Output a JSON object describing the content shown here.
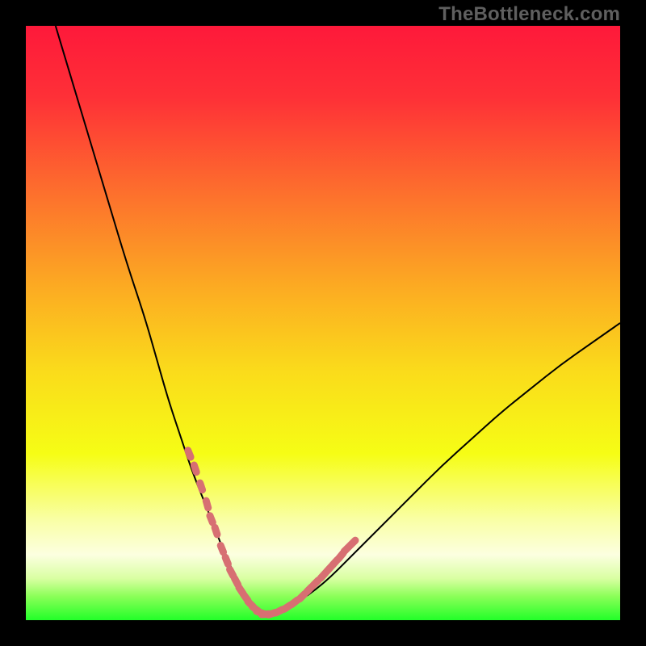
{
  "watermark": "TheBottleneck.com",
  "colors": {
    "frame": "#000000",
    "watermark": "#5f5f5f",
    "curve_stroke": "#000000",
    "marker_fill": "#d76f72",
    "gradient_stops": [
      {
        "offset": 0.0,
        "color": "#fe193a"
      },
      {
        "offset": 0.12,
        "color": "#fe3037"
      },
      {
        "offset": 0.28,
        "color": "#fd6f2d"
      },
      {
        "offset": 0.44,
        "color": "#fcab22"
      },
      {
        "offset": 0.58,
        "color": "#fadb1b"
      },
      {
        "offset": 0.72,
        "color": "#f6fd15"
      },
      {
        "offset": 0.83,
        "color": "#f9ffa4"
      },
      {
        "offset": 0.89,
        "color": "#fcffe0"
      },
      {
        "offset": 0.93,
        "color": "#d9ffa2"
      },
      {
        "offset": 0.96,
        "color": "#8bff58"
      },
      {
        "offset": 1.0,
        "color": "#22ff29"
      }
    ]
  },
  "chart_data": {
    "type": "line",
    "title": "",
    "xlabel": "",
    "ylabel": "",
    "xlim": [
      0,
      100
    ],
    "ylim": [
      0,
      100
    ],
    "grid": false,
    "legend": false,
    "note": "Values are estimated from pixel positions; chart has no axis ticks or labels. x ranges left→right 0–100, y is bottleneck severity 0 (green, bottom) to 100 (red, top).",
    "series": [
      {
        "name": "bottleneck-curve",
        "x": [
          5,
          8,
          11,
          14,
          17,
          20,
          22,
          24,
          26,
          28,
          30,
          32,
          33.5,
          35,
          36.3,
          37.5,
          38.8,
          40,
          45,
          50,
          55,
          60,
          65,
          70,
          75,
          80,
          85,
          90,
          95,
          100
        ],
        "y": [
          100,
          90,
          80,
          70,
          60,
          51,
          44,
          37,
          31,
          25,
          20,
          15,
          11,
          8,
          5.5,
          3.5,
          2,
          1,
          2.5,
          6,
          11,
          16,
          21,
          26,
          30.5,
          35,
          39,
          43,
          46.5,
          50
        ]
      }
    ],
    "markers": {
      "name": "highlighted-points",
      "note": "Pink marker clusters along the curve near the trough.",
      "x": [
        27.5,
        28.5,
        29.5,
        30.5,
        31.2,
        32,
        33,
        33.8,
        34.6,
        35.4,
        36.2,
        37,
        37.8,
        38.6,
        39.4,
        40.3,
        41.4,
        42.6,
        44,
        45.2,
        46.5,
        47.7,
        48.8,
        50,
        51,
        52,
        53,
        54,
        55
      ],
      "y": [
        28,
        25.5,
        22.5,
        19.5,
        17,
        15,
        12,
        10,
        8,
        6.5,
        5,
        3.8,
        2.7,
        1.9,
        1.3,
        1,
        1.1,
        1.5,
        2.2,
        3,
        4,
        5.2,
        6.3,
        7.5,
        8.6,
        9.7,
        10.8,
        12,
        13
      ]
    },
    "minimum": {
      "x": 40,
      "y": 1
    }
  }
}
